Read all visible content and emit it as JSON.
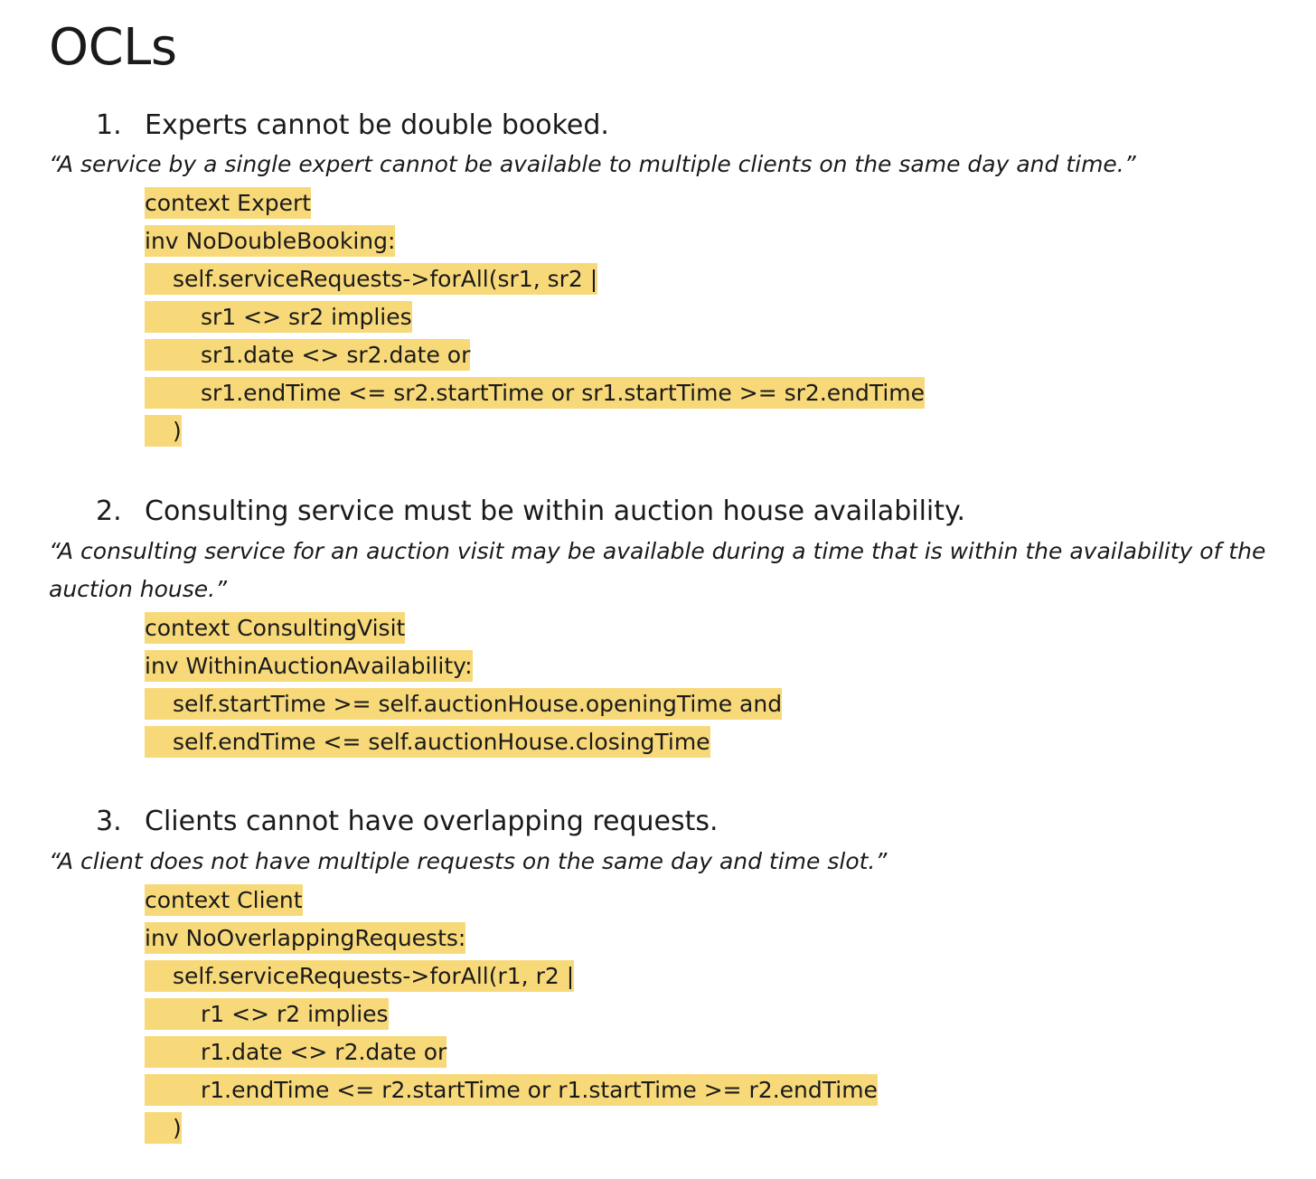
{
  "document": {
    "title": "OCLs"
  },
  "sections": [
    {
      "number": "1.",
      "title": "Experts cannot be double booked.",
      "quote": "“A service by a single expert cannot be available to multiple clients on the same day and time.”",
      "code": [
        "context Expert",
        "inv NoDoubleBooking:",
        "self.serviceRequests->forAll(sr1, sr2 |",
        "sr1 <> sr2 implies",
        "sr1.date <> sr2.date or",
        "sr1.endTime <= sr2.startTime or sr1.startTime >= sr2.endTime",
        ")"
      ]
    },
    {
      "number": "2.",
      "title": "Consulting service must be within auction house availability.",
      "quote": "“A consulting service for an auction visit may be available during a time that is within the availability of the auction house.”",
      "code": [
        "context ConsultingVisit",
        "inv WithinAuctionAvailability:",
        "self.startTime >= self.auctionHouse.openingTime and",
        "self.endTime <= self.auctionHouse.closingTime"
      ]
    },
    {
      "number": "3.",
      "title": "Clients cannot have overlapping requests.",
      "quote": "“A client does not have multiple requests on the same day and time slot.”",
      "code": [
        "context Client",
        "inv NoOverlappingRequests:",
        "self.serviceRequests->forAll(r1, r2 |",
        "r1 <> r2 implies",
        "r1.date <> r2.date or",
        "r1.endTime <= r2.startTime or r1.startTime >= r2.endTime",
        ")"
      ]
    }
  ],
  "colors": {
    "highlight": "#f8d97a",
    "text": "#1a1a1a",
    "background": "#ffffff"
  }
}
